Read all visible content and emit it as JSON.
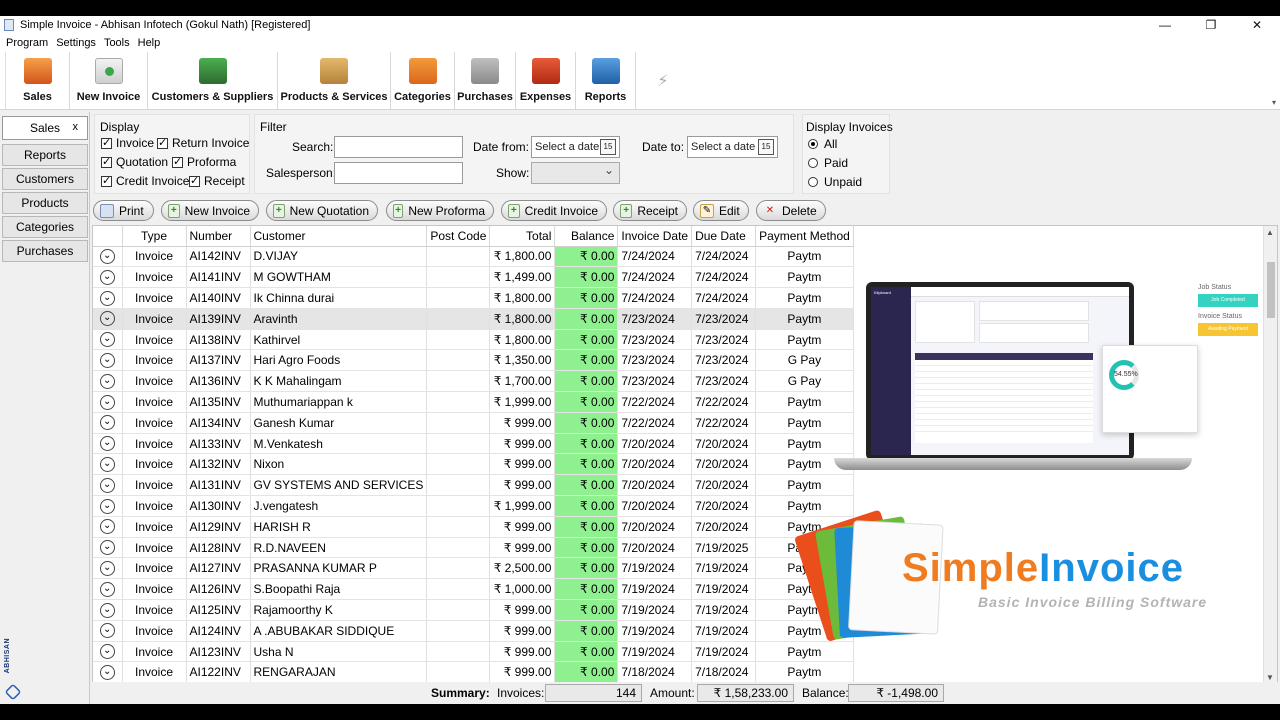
{
  "window": {
    "title": "Simple Invoice - Abhisan Infotech  (Gokul Nath)  [Registered]",
    "minimize": "—",
    "maximize": "❐",
    "close": "✕"
  },
  "menu": [
    "Program",
    "Settings",
    "Tools",
    "Help"
  ],
  "toolbar": [
    {
      "label": "Sales",
      "icon": "sales-icon"
    },
    {
      "label": "New Invoice",
      "icon": "new-invoice-icon"
    },
    {
      "label": "Customers & Suppliers",
      "icon": "customers-icon"
    },
    {
      "label": "Products & Services",
      "icon": "products-icon"
    },
    {
      "label": "Categories",
      "icon": "categories-icon"
    },
    {
      "label": "Purchases",
      "icon": "purchases-icon"
    },
    {
      "label": "Expenses",
      "icon": "expenses-icon"
    },
    {
      "label": "Reports",
      "icon": "reports-icon"
    }
  ],
  "leftnav": {
    "active": "Sales",
    "close": "x",
    "items": [
      "Reports",
      "Customers",
      "Products",
      "Categories",
      "Purchases"
    ],
    "brand": "ABHISAN"
  },
  "display": {
    "title": "Display",
    "checkboxes": [
      {
        "label": "Invoice",
        "checked": true
      },
      {
        "label": "Return Invoice",
        "checked": true
      },
      {
        "label": "Quotation",
        "checked": true
      },
      {
        "label": "Proforma",
        "checked": true
      },
      {
        "label": "Credit Invoice",
        "checked": true
      },
      {
        "label": "Receipt",
        "checked": true
      }
    ]
  },
  "filter": {
    "title": "Filter",
    "search_label": "Search:",
    "search_value": "",
    "salesperson_label": "Salesperson:",
    "salesperson_value": "",
    "date_from_label": "Date from:",
    "date_from_placeholder": "Select a date",
    "date_to_label": "Date to:",
    "date_to_placeholder": "Select a date",
    "calendar_day": "15",
    "show_label": "Show:",
    "show_value": ""
  },
  "display_invoices": {
    "title": "Display Invoices",
    "options": [
      {
        "label": "All",
        "selected": true
      },
      {
        "label": "Paid",
        "selected": false
      },
      {
        "label": "Unpaid",
        "selected": false
      }
    ]
  },
  "actions": [
    "Print",
    "New Invoice",
    "New Quotation",
    "New Proforma",
    "Credit Invoice",
    "Receipt",
    "Edit",
    "Delete"
  ],
  "table": {
    "columns": [
      "",
      "Type",
      "Number",
      "Customer",
      "Post Code",
      "Total",
      "Balance",
      "Invoice Date",
      "Due Date",
      "Payment Method"
    ],
    "selected_row": 3,
    "rows": [
      [
        "Invoice",
        "AI142INV",
        "D.VIJAY",
        "",
        "₹ 1,800.00",
        "₹ 0.00",
        "7/24/2024",
        "7/24/2024",
        "Paytm"
      ],
      [
        "Invoice",
        "AI141INV",
        "M GOWTHAM",
        "",
        "₹ 1,499.00",
        "₹ 0.00",
        "7/24/2024",
        "7/24/2024",
        "Paytm"
      ],
      [
        "Invoice",
        "AI140INV",
        "Ik Chinna durai",
        "",
        "₹ 1,800.00",
        "₹ 0.00",
        "7/24/2024",
        "7/24/2024",
        "Paytm"
      ],
      [
        "Invoice",
        "AI139INV",
        "Aravinth",
        "",
        "₹ 1,800.00",
        "₹ 0.00",
        "7/23/2024",
        "7/23/2024",
        "Paytm"
      ],
      [
        "Invoice",
        "AI138INV",
        "Kathirvel",
        "",
        "₹ 1,800.00",
        "₹ 0.00",
        "7/23/2024",
        "7/23/2024",
        "Paytm"
      ],
      [
        "Invoice",
        "AI137INV",
        "Hari Agro Foods",
        "",
        "₹ 1,350.00",
        "₹ 0.00",
        "7/23/2024",
        "7/23/2024",
        "G Pay"
      ],
      [
        "Invoice",
        "AI136INV",
        "K K Mahalingam",
        "",
        "₹ 1,700.00",
        "₹ 0.00",
        "7/23/2024",
        "7/23/2024",
        "G Pay"
      ],
      [
        "Invoice",
        "AI135INV",
        "Muthumariappan k",
        "",
        "₹ 1,999.00",
        "₹ 0.00",
        "7/22/2024",
        "7/22/2024",
        "Paytm"
      ],
      [
        "Invoice",
        "AI134INV",
        "Ganesh Kumar",
        "",
        "₹ 999.00",
        "₹ 0.00",
        "7/22/2024",
        "7/22/2024",
        "Paytm"
      ],
      [
        "Invoice",
        "AI133INV",
        "M.Venkatesh",
        "",
        "₹ 999.00",
        "₹ 0.00",
        "7/20/2024",
        "7/20/2024",
        "Paytm"
      ],
      [
        "Invoice",
        "AI132INV",
        "Nixon",
        "",
        "₹ 999.00",
        "₹ 0.00",
        "7/20/2024",
        "7/20/2024",
        "Paytm"
      ],
      [
        "Invoice",
        "AI131INV",
        "GV SYSTEMS AND SERVICES",
        "",
        "₹ 999.00",
        "₹ 0.00",
        "7/20/2024",
        "7/20/2024",
        "Paytm"
      ],
      [
        "Invoice",
        "AI130INV",
        "J.vengatesh",
        "",
        "₹ 1,999.00",
        "₹ 0.00",
        "7/20/2024",
        "7/20/2024",
        "Paytm"
      ],
      [
        "Invoice",
        "AI129INV",
        "HARISH R",
        "",
        "₹ 999.00",
        "₹ 0.00",
        "7/20/2024",
        "7/20/2024",
        "Paytm"
      ],
      [
        "Invoice",
        "AI128INV",
        "R.D.NAVEEN",
        "",
        "₹ 999.00",
        "₹ 0.00",
        "7/20/2024",
        "7/19/2025",
        "Paytm"
      ],
      [
        "Invoice",
        "AI127INV",
        "PRASANNA KUMAR P",
        "",
        "₹ 2,500.00",
        "₹ 0.00",
        "7/19/2024",
        "7/19/2024",
        "Paytm"
      ],
      [
        "Invoice",
        "AI126INV",
        "S.Boopathi Raja",
        "",
        "₹ 1,000.00",
        "₹ 0.00",
        "7/19/2024",
        "7/19/2024",
        "Paytm"
      ],
      [
        "Invoice",
        "AI125INV",
        "Rajamoorthy K",
        "",
        "₹ 999.00",
        "₹ 0.00",
        "7/19/2024",
        "7/19/2024",
        "Paytm"
      ],
      [
        "Invoice",
        "AI124INV",
        " A .ABUBAKAR SIDDIQUE",
        "",
        "₹ 999.00",
        "₹ 0.00",
        "7/19/2024",
        "7/19/2024",
        "Paytm"
      ],
      [
        "Invoice",
        "AI123INV",
        "Usha N",
        "",
        "₹ 999.00",
        "₹ 0.00",
        "7/19/2024",
        "7/19/2024",
        "Paytm"
      ],
      [
        "Invoice",
        "AI122INV",
        "RENGARAJAN",
        "",
        "₹ 999.00",
        "₹ 0.00",
        "7/18/2024",
        "7/18/2024",
        "Paytm"
      ]
    ]
  },
  "promo": {
    "laptop": {
      "sidebar_title": "Klipboard",
      "job_status": "Job Status",
      "job_status_badge": "Job Completed",
      "invoice_status": "Invoice Status",
      "invoice_status_badge": "Awaiting Payment",
      "ring_value": "54.55%"
    },
    "logo_a": "Simple",
    "logo_b": "Invoice",
    "tagline": "Basic Invoice Billing Software"
  },
  "summary": {
    "label": "Summary:",
    "invoices_label": "Invoices:",
    "invoices_value": "144",
    "amount_label": "Amount:",
    "amount_value": "₹ 1,58,233.00",
    "balance_label": "Balance:",
    "balance_value": "₹ -1,498.00"
  },
  "colors": {
    "balance_paid": "#8ef08e",
    "selected_row": "#e5e5e5",
    "logo_orange": "#f07c21",
    "logo_blue": "#1a8fe0"
  }
}
